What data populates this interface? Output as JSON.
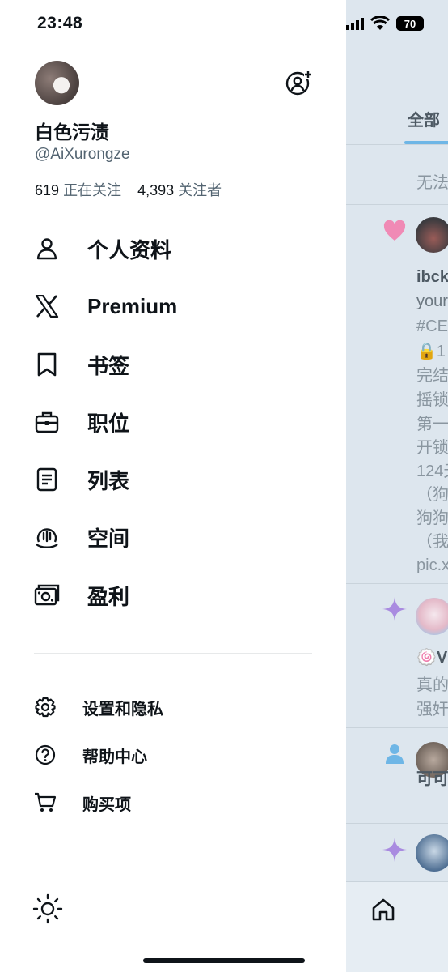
{
  "status_bar": {
    "time": "23:48",
    "battery": "70"
  },
  "profile": {
    "display_name": "白色污渍",
    "handle": "@AiXurongze",
    "following_count": "619",
    "following_label": "正在关注",
    "followers_count": "4,393",
    "followers_label": "关注者"
  },
  "menu": [
    {
      "label": "个人资料",
      "icon": "person-icon"
    },
    {
      "label": "Premium",
      "icon": "x-logo-icon"
    },
    {
      "label": "书签",
      "icon": "bookmark-icon"
    },
    {
      "label": "职位",
      "icon": "briefcase-icon"
    },
    {
      "label": "列表",
      "icon": "list-icon"
    },
    {
      "label": "空间",
      "icon": "spaces-icon"
    },
    {
      "label": "盈利",
      "icon": "monetization-icon"
    }
  ],
  "secondary_menu": [
    {
      "label": "设置和隐私",
      "icon": "gear-icon"
    },
    {
      "label": "帮助中心",
      "icon": "help-icon"
    },
    {
      "label": "购买项",
      "icon": "cart-icon"
    }
  ],
  "feed": {
    "tab": "全部",
    "notice": "无法",
    "lines": [
      "ibck",
      "your",
      "#CE",
      "🔒1",
      "完结",
      "摇锁",
      "第一",
      "开锁",
      "124夭",
      "（狗",
      "狗狗",
      "（我",
      "pic.x",
      "🍥V",
      "真的",
      "强奸",
      "可可"
    ]
  },
  "colors": {
    "accent": "#1d9bf0",
    "heart": "#f08ab5",
    "sparkle": "#a98be0"
  }
}
